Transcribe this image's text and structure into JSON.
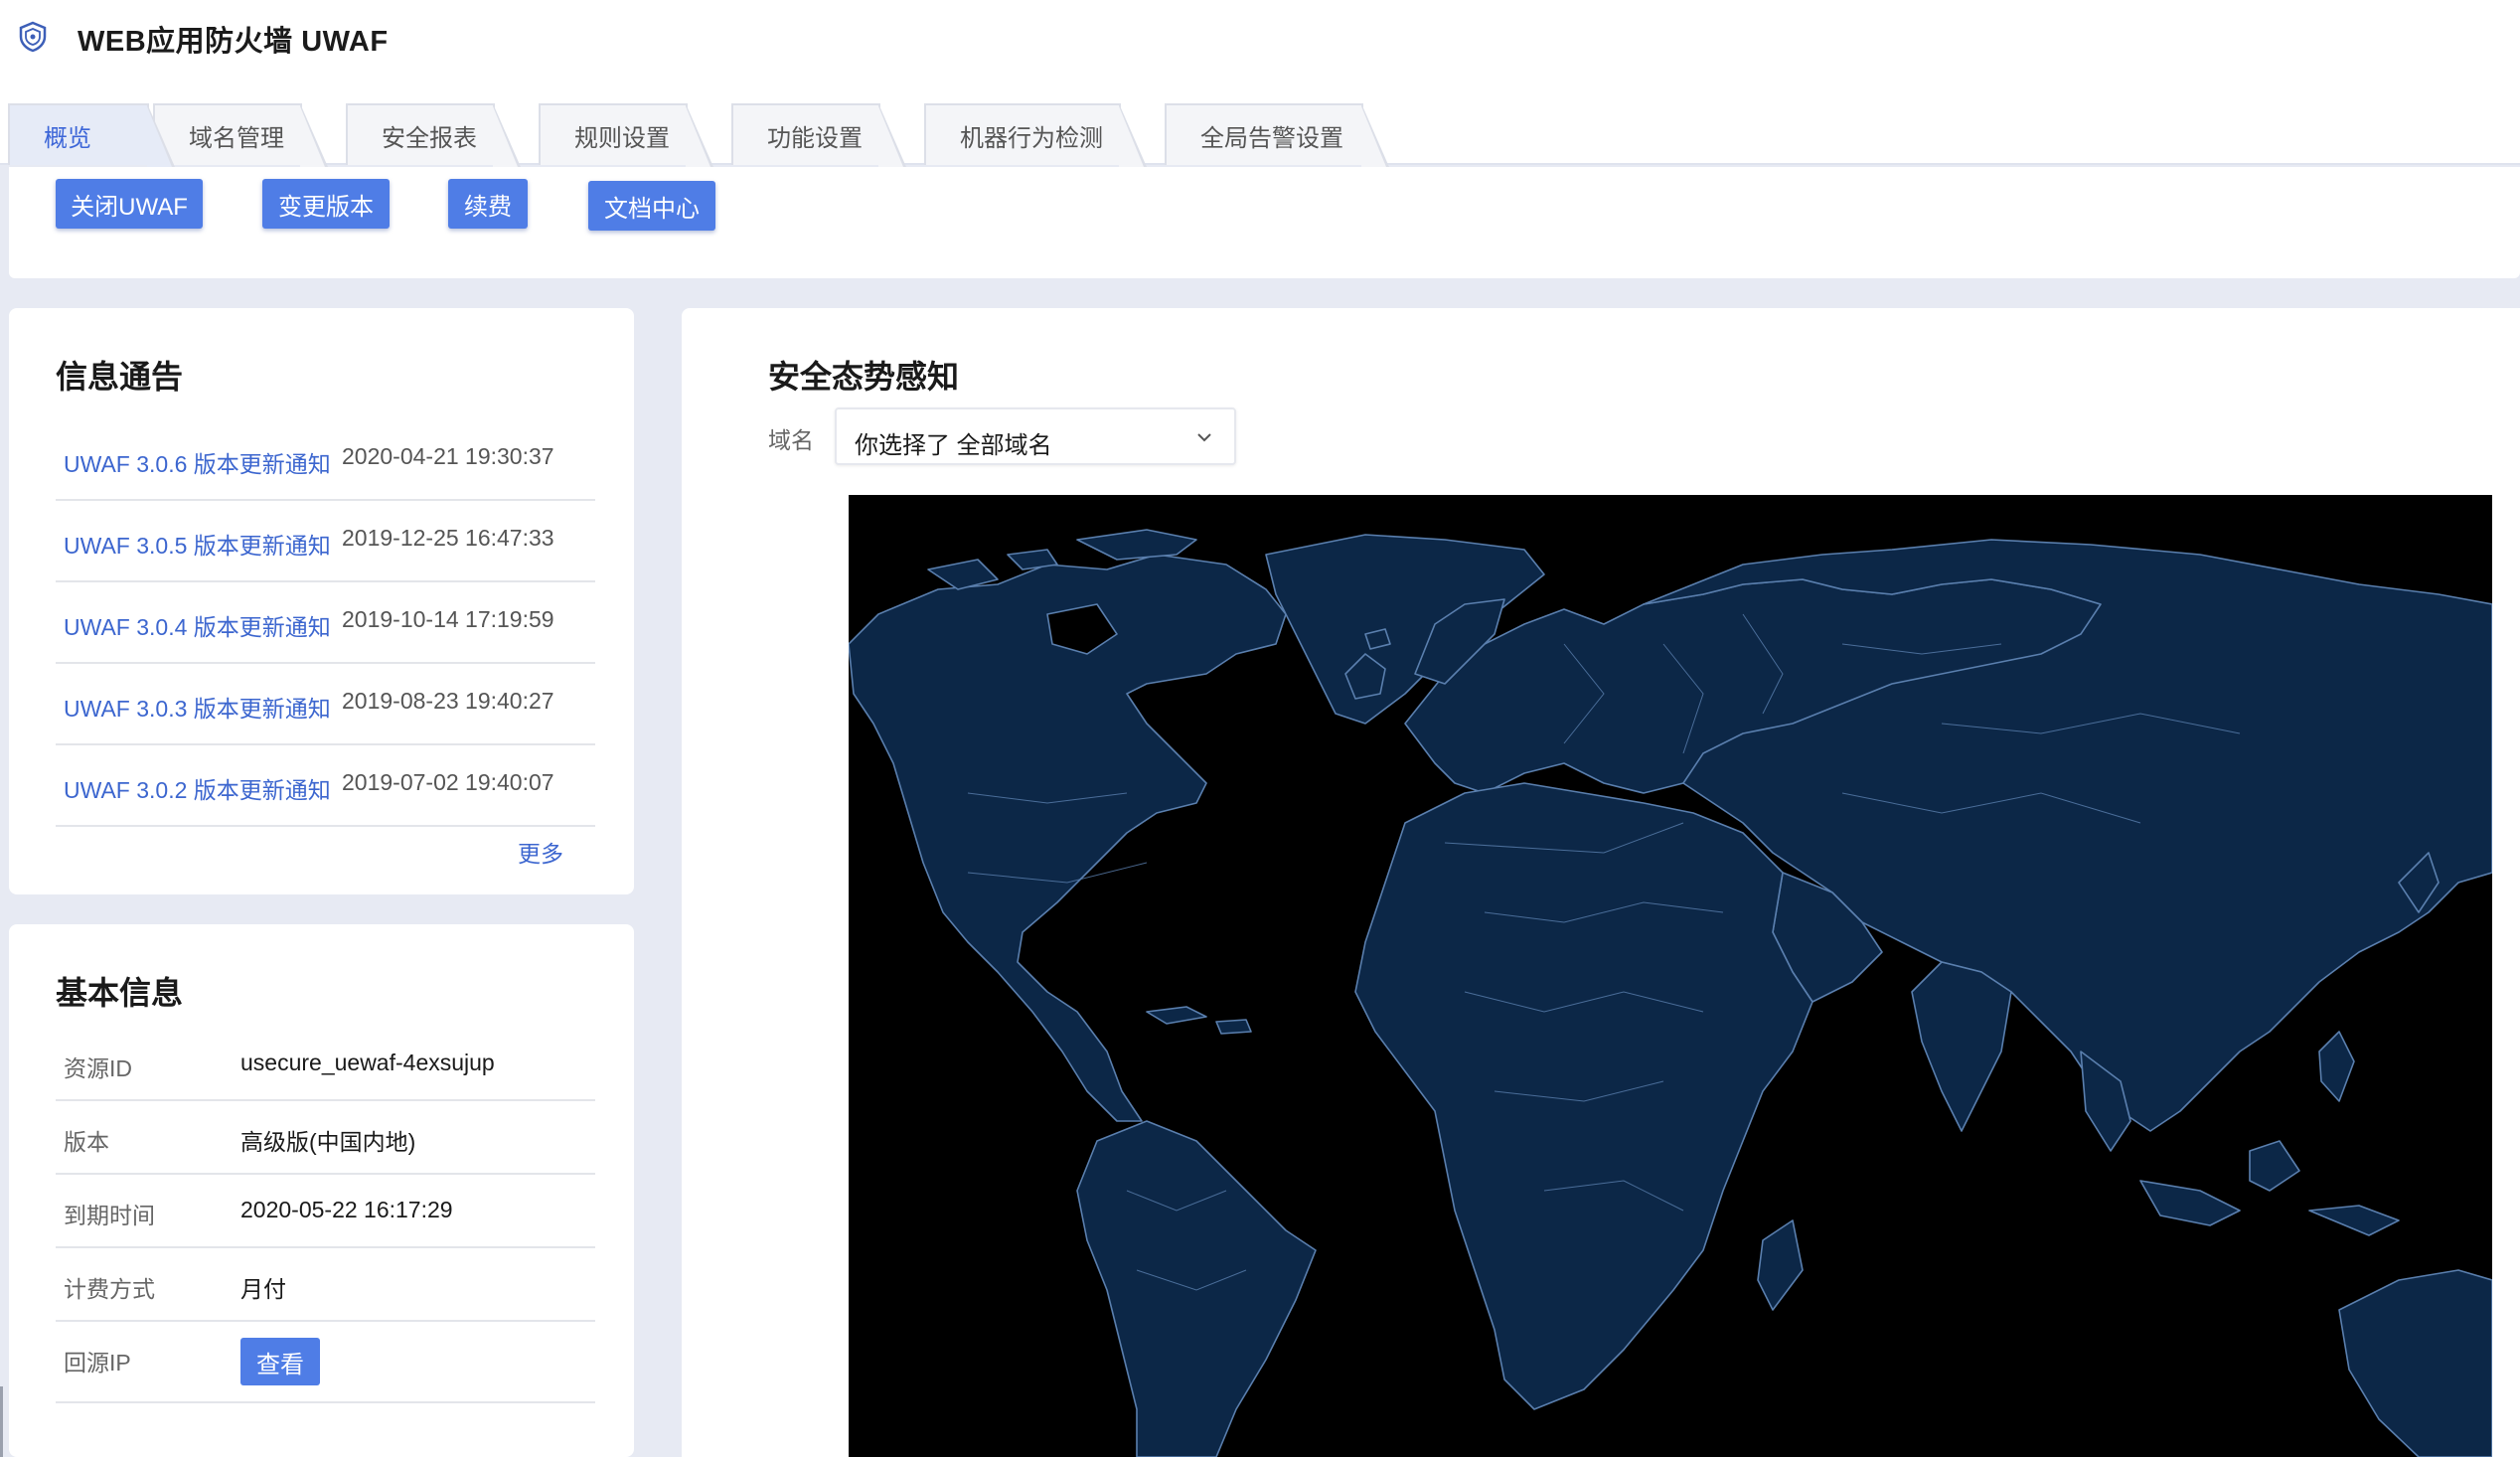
{
  "app": {
    "title": "WEB应用防火墙 UWAF",
    "logo_icon": "shield-icon"
  },
  "tabs": [
    {
      "label": "概览",
      "active": true
    },
    {
      "label": "域名管理",
      "active": false
    },
    {
      "label": "安全报表",
      "active": false
    },
    {
      "label": "规则设置",
      "active": false
    },
    {
      "label": "功能设置",
      "active": false
    },
    {
      "label": "机器行为检测",
      "active": false
    },
    {
      "label": "全局告警设置",
      "active": false
    }
  ],
  "actions": {
    "close_uwaf": "关闭UWAF",
    "change_version": "变更版本",
    "renew": "续费",
    "docs_center": "文档中心"
  },
  "notices": {
    "title": "信息通告",
    "items": [
      {
        "title": "UWAF 3.0.6 版本更新通知",
        "time": "2020-04-21 19:30:37"
      },
      {
        "title": "UWAF 3.0.5 版本更新通知",
        "time": "2019-12-25 16:47:33"
      },
      {
        "title": "UWAF 3.0.4 版本更新通知",
        "time": "2019-10-14 17:19:59"
      },
      {
        "title": "UWAF 3.0.3 版本更新通知",
        "time": "2019-08-23 19:40:27"
      },
      {
        "title": "UWAF 3.0.2 版本更新通知",
        "time": "2019-07-02 19:40:07"
      }
    ],
    "more": "更多"
  },
  "basic_info": {
    "title": "基本信息",
    "rows": [
      {
        "label": "资源ID",
        "value": "usecure_uewaf-4exsujup"
      },
      {
        "label": "版本",
        "value": "高级版(中国内地)"
      },
      {
        "label": "到期时间",
        "value": "2020-05-22 16:17:29"
      },
      {
        "label": "计费方式",
        "value": "月付"
      },
      {
        "label": "回源IP",
        "button": "查看"
      }
    ]
  },
  "situation": {
    "title": "安全态势感知",
    "domain_label": "域名",
    "domain_select": "你选择了 全部域名",
    "map_icon": "world-map",
    "colors": {
      "land": "#0c2747",
      "border": "#5a7fae",
      "ocean": "#000000"
    }
  },
  "colors": {
    "accent": "#4f7de6",
    "link": "#3c66cf",
    "background": "#e7eaf3"
  }
}
